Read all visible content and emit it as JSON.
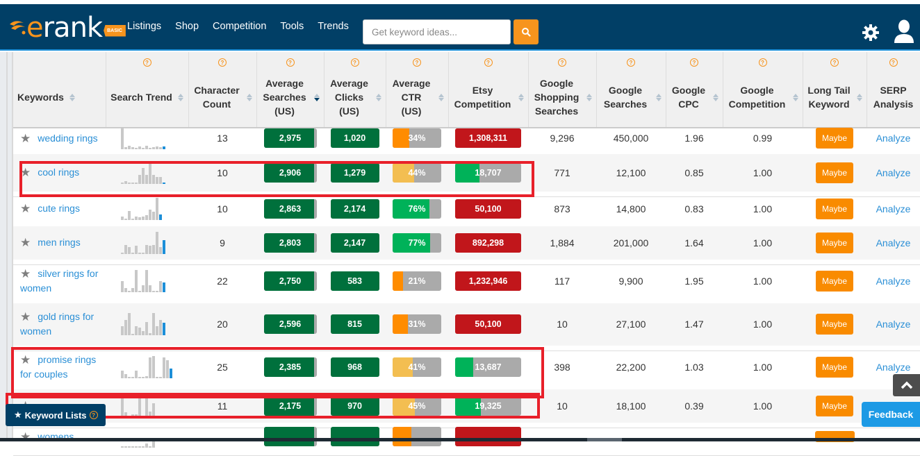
{
  "app": {
    "logo_text": "erank",
    "logo_badge": "BASIC",
    "nav": [
      "Listings",
      "Shop",
      "Competition",
      "Tools",
      "Trends"
    ],
    "search_placeholder": "Get keyword ideas...",
    "icons": {
      "search": "search-icon",
      "settings": "gear-icon",
      "account": "user-icon"
    }
  },
  "colors": {
    "navbar": "#013f66",
    "accent_orange": "#f7941d",
    "dark_green": "#00703c",
    "bright_green": "#00b259",
    "red": "#c1161b",
    "light_orange": "#f3be51",
    "orange": "#ff8c00",
    "grey": "#aaaaaa",
    "link_blue": "#2a8fd6",
    "highlight_red": "#e8202a"
  },
  "table": {
    "columns": [
      {
        "label": "Keywords",
        "help": false,
        "sort": "none"
      },
      {
        "label": "Search Trend",
        "help": true,
        "sort": "none"
      },
      {
        "label": "Character Count",
        "help": true,
        "sort": "none"
      },
      {
        "label": "Average Searches (US)",
        "help": true,
        "sort": "desc"
      },
      {
        "label": "Average Clicks (US)",
        "help": true,
        "sort": "none"
      },
      {
        "label": "Average CTR (US)",
        "help": true,
        "sort": "none"
      },
      {
        "label": "Etsy Competition",
        "help": true,
        "sort": "none"
      },
      {
        "label": "Google Shopping Searches",
        "help": true,
        "sort": "none"
      },
      {
        "label": "Google Searches",
        "help": true,
        "sort": "none"
      },
      {
        "label": "Google CPC",
        "help": true,
        "sort": "none"
      },
      {
        "label": "Google Competition",
        "help": true,
        "sort": "none"
      },
      {
        "label": "Long Tail Keyword",
        "help": true,
        "sort": "none"
      },
      {
        "label": "SERP Analysis",
        "help": true,
        "sort": "none"
      }
    ],
    "rows": [
      {
        "keyword": "wedding rings",
        "trend": [
          1,
          0.1,
          0.15,
          0.1,
          0.08,
          0.12,
          0.05,
          0.15,
          0.05,
          0.1,
          0.12,
          0.1,
          0.14
        ],
        "chars": "13",
        "searches": "2,975",
        "searches_fill": 0.96,
        "clicks": "1,020",
        "clicks_fill": 1.0,
        "ctr": "34%",
        "ctr_fill": 0.34,
        "ctr_color": "orange",
        "etsy": "1,308,311",
        "etsy_fill": 1.0,
        "etsy_color": "red",
        "g_shopping": "9,296",
        "g_searches": "450,000",
        "g_cpc": "1.96",
        "g_comp": "0.99",
        "long_tail": "Maybe",
        "serp": "Analyze"
      },
      {
        "keyword": "cool rings",
        "trend": [
          0.05,
          0.1,
          0.05,
          0.05,
          0.05,
          0.4,
          0.7,
          0.4,
          0.9,
          0.4,
          0.3,
          0.3,
          0.05
        ],
        "chars": "10",
        "searches": "2,906",
        "searches_fill": 0.96,
        "clicks": "1,279",
        "clicks_fill": 1.0,
        "ctr": "44%",
        "ctr_fill": 0.44,
        "ctr_color": "light_orange",
        "etsy": "18,707",
        "etsy_fill": 0.37,
        "etsy_color": "bright_green",
        "g_shopping": "771",
        "g_searches": "12,100",
        "g_cpc": "0.85",
        "g_comp": "1.00",
        "long_tail": "Maybe",
        "serp": "Analyze",
        "highlighted": true
      },
      {
        "keyword": "cute rings",
        "trend": [
          0.15,
          0.05,
          0.4,
          0.05,
          0.15,
          0.12,
          0.15,
          0.2,
          0.45,
          0.35,
          1,
          0.25
        ],
        "chars": "10",
        "searches": "2,863",
        "searches_fill": 0.96,
        "clicks": "2,174",
        "clicks_fill": 1.0,
        "ctr": "76%",
        "ctr_fill": 0.76,
        "ctr_color": "bright_green",
        "etsy": "50,100",
        "etsy_fill": 1.0,
        "etsy_color": "red",
        "g_shopping": "873",
        "g_searches": "14,800",
        "g_cpc": "0.83",
        "g_comp": "1.00",
        "long_tail": "Maybe",
        "serp": "Analyze"
      },
      {
        "keyword": "men rings",
        "trend": [
          0.05,
          0.4,
          0.3,
          0.05,
          0.35,
          0.05,
          0.05,
          0.4,
          0.35,
          0.4,
          1,
          0.3,
          0.6
        ],
        "chars": "9",
        "searches": "2,803",
        "searches_fill": 0.96,
        "clicks": "2,147",
        "clicks_fill": 1.0,
        "ctr": "77%",
        "ctr_fill": 0.77,
        "ctr_color": "bright_green",
        "etsy": "892,298",
        "etsy_fill": 1.0,
        "etsy_color": "red",
        "g_shopping": "1,884",
        "g_searches": "201,000",
        "g_cpc": "1.64",
        "g_comp": "1.00",
        "long_tail": "Maybe",
        "serp": "Analyze"
      },
      {
        "keyword": "silver rings for women",
        "trend": [
          0.5,
          0.2,
          0.05,
          0.2,
          1,
          0.05,
          0.3,
          1,
          0.3,
          0.05,
          0.05,
          0.5,
          0.45
        ],
        "chars": "22",
        "searches": "2,750",
        "searches_fill": 0.96,
        "clicks": "583",
        "clicks_fill": 1.0,
        "ctr": "21%",
        "ctr_fill": 0.21,
        "ctr_color": "orange",
        "etsy": "1,232,946",
        "etsy_fill": 1.0,
        "etsy_color": "red",
        "g_shopping": "117",
        "g_searches": "9,900",
        "g_cpc": "1.95",
        "g_comp": "1.00",
        "long_tail": "Maybe",
        "serp": "Analyze"
      },
      {
        "keyword": "gold rings for women",
        "trend": [
          0.4,
          0.7,
          1,
          0.05,
          0.4,
          0.35,
          0.2,
          0.6,
          0.1,
          1,
          0.4,
          0.7,
          0.55
        ],
        "chars": "20",
        "searches": "2,596",
        "searches_fill": 0.96,
        "clicks": "815",
        "clicks_fill": 1.0,
        "ctr": "31%",
        "ctr_fill": 0.31,
        "ctr_color": "orange",
        "etsy": "50,100",
        "etsy_fill": 1.0,
        "etsy_color": "red",
        "g_shopping": "10",
        "g_searches": "27,100",
        "g_cpc": "1.47",
        "g_comp": "1.00",
        "long_tail": "Maybe",
        "serp": "Analyze"
      },
      {
        "keyword": "promise rings for couples",
        "trend": [
          0.35,
          0.2,
          0.05,
          0.05,
          0.35,
          0.05,
          0.05,
          0.1,
          0.95,
          1,
          0.05,
          0.05,
          0.95,
          0.8,
          0.45
        ],
        "chars": "25",
        "searches": "2,385",
        "searches_fill": 0.96,
        "clicks": "968",
        "clicks_fill": 1.0,
        "ctr": "41%",
        "ctr_fill": 0.41,
        "ctr_color": "light_orange",
        "etsy": "13,687",
        "etsy_fill": 0.27,
        "etsy_color": "bright_green",
        "g_shopping": "398",
        "g_searches": "22,200",
        "g_cpc": "1.03",
        "g_comp": "1.00",
        "long_tail": "Maybe",
        "serp": "Analyze",
        "highlighted": true
      },
      {
        "keyword": "",
        "trend": [
          1,
          0.2,
          0.05,
          0.1,
          0.1,
          1,
          0.05,
          1,
          0.25,
          0.6
        ],
        "chars": "11",
        "searches": "2,175",
        "searches_fill": 0.96,
        "clicks": "970",
        "clicks_fill": 1.0,
        "ctr": "45%",
        "ctr_fill": 0.45,
        "ctr_color": "light_orange",
        "etsy": "19,325",
        "etsy_fill": 0.39,
        "etsy_color": "bright_green",
        "g_shopping": "10",
        "g_searches": "18,100",
        "g_cpc": "0.39",
        "g_comp": "1.00",
        "long_tail": "Maybe",
        "serp": "Analyze",
        "highlighted": true
      },
      {
        "keyword": "womens",
        "trend": [
          0.05,
          0.05,
          0.05,
          0.05,
          0.05,
          0.05,
          0.05,
          0.2,
          0.05,
          0.35
        ],
        "chars": "",
        "searches": "",
        "searches_fill": 0.96,
        "clicks": "",
        "clicks_fill": 1.0,
        "ctr": "",
        "ctr_fill": 0.38,
        "ctr_color": "orange",
        "etsy": "",
        "etsy_fill": 1.0,
        "etsy_color": "red",
        "g_shopping": "",
        "g_searches": "",
        "g_cpc": "",
        "g_comp": "",
        "long_tail": "",
        "serp": ""
      }
    ]
  },
  "floating": {
    "keyword_lists": "Keyword Lists",
    "feedback": "Feedback"
  }
}
